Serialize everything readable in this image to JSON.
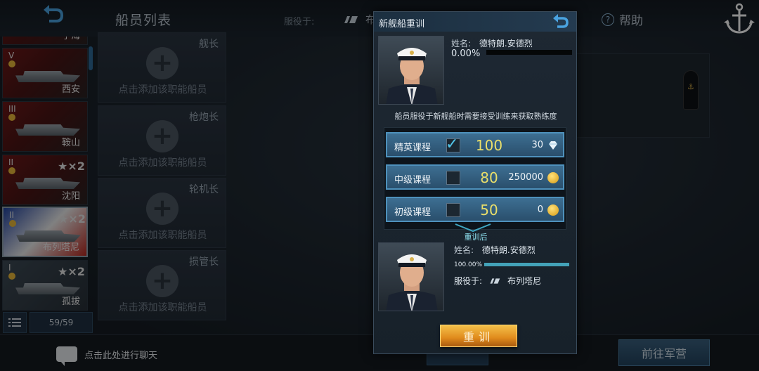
{
  "header": {
    "title": "船员列表",
    "serve_label": "服役于:",
    "serve_ship": "布列塔尼",
    "help": "帮助"
  },
  "ship_list": {
    "ships": [
      {
        "tier": "",
        "name": "宁海",
        "star": ""
      },
      {
        "tier": "V",
        "name": "西安",
        "star": ""
      },
      {
        "tier": "III",
        "name": "鞍山",
        "star": ""
      },
      {
        "tier": "II",
        "name": "沈阳",
        "star": "★×2"
      },
      {
        "tier": "II",
        "name": "布列塔尼",
        "star": "★×2"
      },
      {
        "tier": "I",
        "name": "孤拔",
        "star": "★×2"
      }
    ],
    "count": "59/59"
  },
  "slots": [
    {
      "role": "舰长",
      "hint": "点击添加该职能船员"
    },
    {
      "role": "枪炮长",
      "hint": "点击添加该职能船员"
    },
    {
      "role": "轮机长",
      "hint": "点击添加该职能船员"
    },
    {
      "role": "损管长",
      "hint": "点击添加该职能船员"
    }
  ],
  "bottom": {
    "chat": "点击此处进行聊天",
    "goto_barracks": "前往军营"
  },
  "modal": {
    "title": "新舰船重训",
    "before": {
      "name_label": "姓名:",
      "name": "德特朗.安德烈",
      "progress_text": "0.00%",
      "progress": 0.0
    },
    "description": "船员服役于新舰船时需要接受训练来获取熟练度",
    "courses": [
      {
        "name": "精英课程",
        "value": "100",
        "cost": "30",
        "currency": "diamond-icon",
        "checked": true
      },
      {
        "name": "中级课程",
        "value": "80",
        "cost": "250000",
        "currency": "gold-coin-icon",
        "checked": false
      },
      {
        "name": "初级课程",
        "value": "50",
        "cost": "0",
        "currency": "gold-coin-icon",
        "checked": false
      }
    ],
    "after_label": "重训后",
    "after": {
      "name_label": "姓名:",
      "name": "德特朗.安德烈",
      "progress_text": "100.00%",
      "progress": 1.0,
      "serve_label": "服役于:",
      "serve_ship": "布列塔尼"
    },
    "retrain_button": "重训"
  },
  "colors": {
    "accent": "#4e91bc",
    "value_yellow": "#eadf6a",
    "progress": "#43a2b8",
    "retrain_orange": "#e08a1c"
  }
}
